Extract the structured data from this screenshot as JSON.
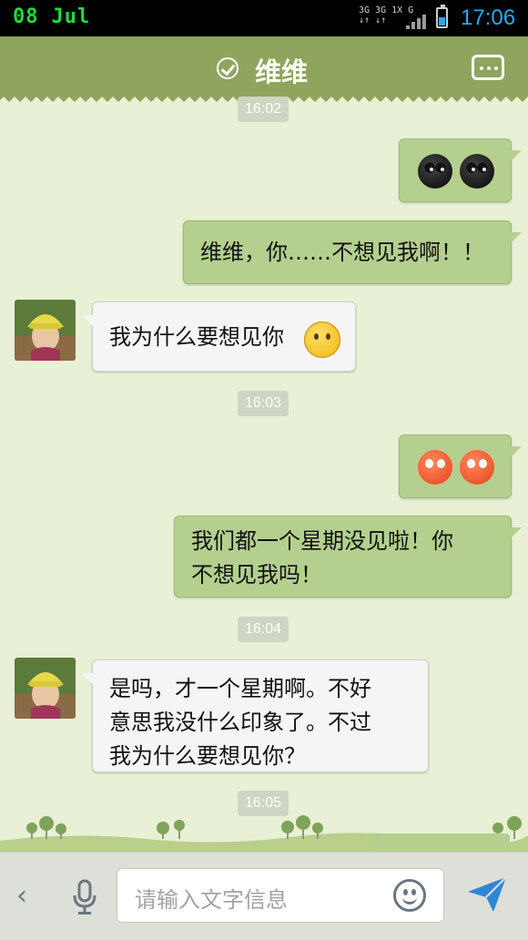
{
  "status_bar": {
    "date_day": "08",
    "date_month": "Jul",
    "network_top": "3G 3G 1X G",
    "network_bottom": "↓↑ ↓↑",
    "time": "17:06"
  },
  "header": {
    "title": "维维"
  },
  "messages": [
    {
      "timestamp": "16:02"
    },
    {
      "outgoing_emojis": [
        "crying-face",
        "crying-face"
      ]
    },
    {
      "outgoing_text": "维维，你……不想见我啊！！"
    },
    {
      "incoming_text": "我为什么要想见你",
      "incoming_emoji": "worried-face"
    },
    {
      "timestamp": "16:03"
    },
    {
      "outgoing_emojis": [
        "angry-face",
        "angry-face"
      ]
    },
    {
      "outgoing_text_line1": "我们都一个星期没见啦！你",
      "outgoing_text_line2": "不想见我吗！"
    },
    {
      "timestamp": "16:04"
    },
    {
      "incoming_text_line1": "是吗，才一个星期啊。不好",
      "incoming_text_line2": "意思我没什么印象了。不过",
      "incoming_text_line3": "我为什么要想见你？"
    },
    {
      "timestamp": "16:05"
    }
  ],
  "input": {
    "placeholder": "请输入文字信息"
  },
  "colors": {
    "header": "#8fa55e",
    "background": "#e8f0d6",
    "outgoing_bubble": "#b4cf8e",
    "incoming_bubble": "#f5f5f5",
    "time_accent": "#29a9f0"
  }
}
